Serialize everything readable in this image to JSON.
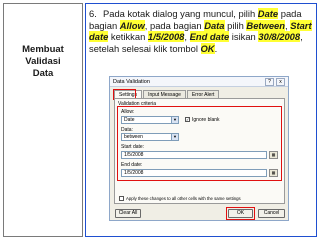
{
  "sidebar": {
    "title_line1": "Membuat",
    "title_line2": "Validasi",
    "title_line3": "Data"
  },
  "instruction": {
    "number": "6.",
    "t1": "Pada kotak dialog yang muncul, pilih ",
    "h1": "Date",
    "t2": " pada bagian ",
    "h2": "Allow",
    "t3": ", pada bagian ",
    "h3": "Data",
    "t4": " pilih ",
    "h4": "Between",
    "t5": ", ",
    "h5": "Start date",
    "t6": " ketikkan ",
    "h6": "1/5/2008",
    "t7": ", ",
    "h7": "End date",
    "t8": " isikan ",
    "h8": "30/8/2008",
    "t9": ", setelah selesai klik tombol ",
    "h9": "OK",
    "t10": "."
  },
  "dialog": {
    "title": "Data Validation",
    "help_icon": "?",
    "close_icon": "x",
    "tabs": [
      "Settings",
      "Input Message",
      "Error Alert"
    ],
    "criteria_label": "Validation criteria",
    "allow_label": "Allow:",
    "allow_value": "Date",
    "ignore_blank": "Ignore blank",
    "data_label": "Data:",
    "data_value": "between",
    "start_label": "Start date:",
    "start_value": "1/5/2008",
    "end_label": "End date:",
    "end_value": "1/5/2008",
    "apply_label": "Apply these changes to all other cells with the same settings",
    "clear_all": "Clear All",
    "ok": "OK",
    "cancel": "Cancel"
  },
  "colors": {
    "highlight": "#ffff33",
    "annotation": "#e01010",
    "right_frame": "#1f4fd0"
  }
}
